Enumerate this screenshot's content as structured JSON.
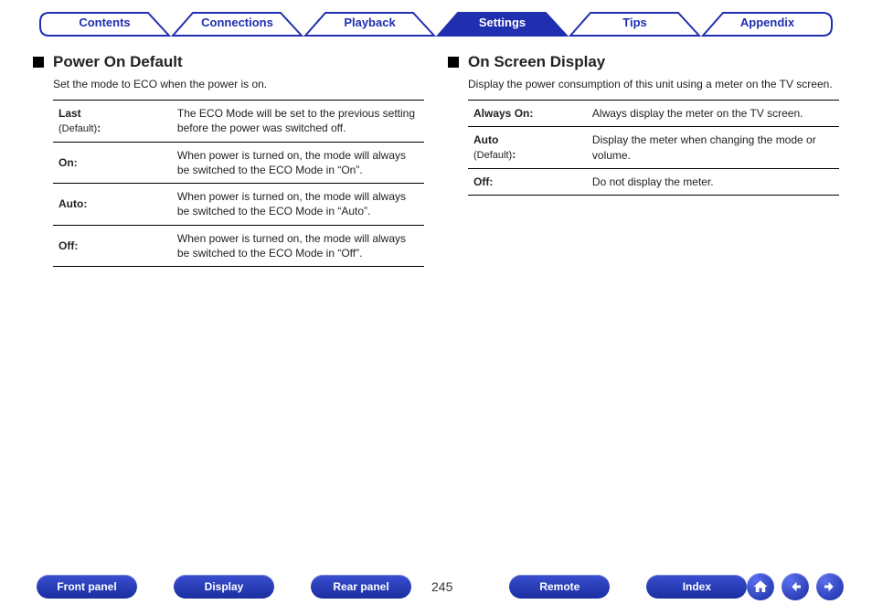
{
  "topnav": {
    "tabs": [
      {
        "label": "Contents"
      },
      {
        "label": "Connections"
      },
      {
        "label": "Playback"
      },
      {
        "label": "Settings",
        "active": true
      },
      {
        "label": "Tips"
      },
      {
        "label": "Appendix"
      }
    ]
  },
  "left": {
    "title": "Power On Default",
    "desc": "Set the mode to ECO when the power is on.",
    "rows": [
      {
        "term": "Last",
        "default": "(Default)",
        "colon": ":",
        "value": "The ECO Mode will be set to the previous setting before the power was switched off."
      },
      {
        "term": "On:",
        "value": "When power is turned on, the mode will always be switched to the ECO Mode in “On”."
      },
      {
        "term": "Auto:",
        "value": "When power is turned on, the mode will always be switched to the ECO Mode in “Auto”."
      },
      {
        "term": "Off:",
        "value": "When power is turned on, the mode will always be switched to the ECO Mode in “Off”."
      }
    ]
  },
  "right": {
    "title": "On Screen Display",
    "desc": "Display the power consumption of this unit using a meter on the TV screen.",
    "rows": [
      {
        "term": "Always On:",
        "value": "Always display the meter on the TV screen."
      },
      {
        "term": "Auto",
        "default": "(Default)",
        "colon": ":",
        "value": "Display the meter when changing the mode or volume."
      },
      {
        "term": "Off:",
        "value": "Do not display the meter."
      }
    ]
  },
  "bottom": {
    "buttons_left": [
      "Front panel",
      "Display",
      "Rear panel"
    ],
    "page": "245",
    "buttons_right": [
      "Remote",
      "Index"
    ]
  }
}
